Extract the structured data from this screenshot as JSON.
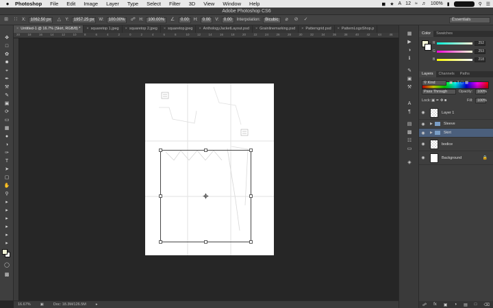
{
  "menubar": {
    "apple": "",
    "items": [
      "Photoshop",
      "File",
      "Edit",
      "Image",
      "Layer",
      "Type",
      "Select",
      "Filter",
      "3D",
      "View",
      "Window",
      "Help"
    ],
    "status": {
      "notif": "12",
      "battery": "100%"
    }
  },
  "window": {
    "title": "Adobe Photoshop CS6"
  },
  "options": {
    "x_label": "X:",
    "x_value": "1062.50 px",
    "y_label": "Y:",
    "y_value": "1957.25 px",
    "w_label": "W:",
    "w_value": "100.00%",
    "h_label": "H:",
    "h_value": "100.00%",
    "angle_value": "0.00",
    "hskew_label": "H:",
    "hskew_value": "0.00",
    "vskew_label": "V:",
    "vskew_value": "0.00",
    "interp_label": "Interpolation:",
    "interp_value": "Bicubic",
    "workspace": "Essentials"
  },
  "tabs": [
    {
      "label": "Untitled-1 @ 16.7% (Skirt, RGB/8) *",
      "active": true
    },
    {
      "label": "squaretop 1.jpeg",
      "active": false
    },
    {
      "label": "squaretop 2.jpeg",
      "active": false
    },
    {
      "label": "squaretop.jpeg",
      "active": false
    },
    {
      "label": "AnthologyJacketLayout.psd",
      "active": false
    },
    {
      "label": "Grainlinemarking.psd",
      "active": false
    },
    {
      "label": "Patterngrid.psd",
      "active": false
    },
    {
      "label": "PatternLogoShop.p",
      "active": false
    }
  ],
  "rulers": {
    "h": [
      "20",
      "18",
      "16",
      "14",
      "12",
      "10",
      "8",
      "6",
      "4",
      "2",
      "0",
      "2",
      "4",
      "6",
      "8",
      "10",
      "12",
      "14",
      "16",
      "18",
      "20",
      "22",
      "24",
      "26",
      "28",
      "30",
      "32",
      "34",
      "36",
      "38",
      "40",
      "42",
      "44",
      "46"
    ]
  },
  "status": {
    "zoom": "16.67%",
    "doc": "Doc: 18.3M/126.5M"
  },
  "color_panel": {
    "tabs": [
      "Color",
      "Swatches"
    ],
    "r_label": "R",
    "r_value": "252",
    "g_label": "G",
    "g_value": "253",
    "b_label": "B",
    "b_value": "218",
    "fg_color": "#fcfdda"
  },
  "layers_panel": {
    "tabs": [
      "Layers",
      "Channels",
      "Paths"
    ],
    "kind": "Kind",
    "blend_mode": "Pass Through",
    "opacity_label": "Opacity:",
    "opacity_value": "100%",
    "lock_label": "Lock:",
    "fill_label": "Fill:",
    "fill_value": "100%",
    "layers": [
      "Layer 1",
      "Sleeve",
      "Skirt",
      "bodice",
      "Background"
    ],
    "selected_layer": "Skirt"
  }
}
